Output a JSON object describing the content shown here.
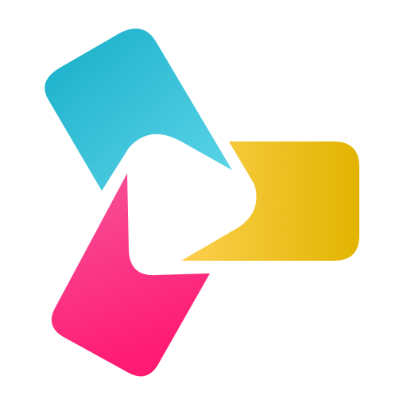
{
  "icon": {
    "name": "play-logo-icon",
    "colors": {
      "background": "#ffffff",
      "cyan_light": "#5fd6ea",
      "cyan_dark": "#16aec8",
      "yellow_light": "#fcd04f",
      "yellow_dark": "#e2b400",
      "pink_light": "#f6559a",
      "pink_dark": "#ff1a73"
    }
  }
}
